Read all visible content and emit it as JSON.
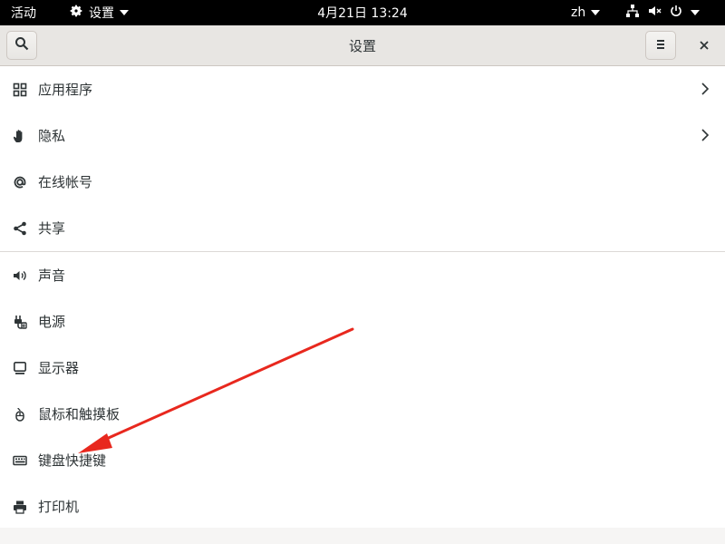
{
  "topbar": {
    "activities": "活动",
    "app_name": "设置",
    "clock": "4月21日  13:24",
    "language": "zh",
    "icons": [
      "network-icon",
      "mute-icon",
      "power-icon"
    ]
  },
  "header": {
    "title": "设置",
    "search_icon": "search-icon",
    "menu_icon": "hamburger-icon",
    "close_icon": "close-icon"
  },
  "sections": [
    {
      "items": [
        {
          "label": "应用程序",
          "icon": "apps-grid-icon",
          "has_chevron": true
        },
        {
          "label": "隐私",
          "icon": "hand-icon",
          "has_chevron": true
        },
        {
          "label": "在线帐号",
          "icon": "at-icon",
          "has_chevron": false
        },
        {
          "label": "共享",
          "icon": "share-icon",
          "has_chevron": false
        }
      ]
    },
    {
      "items": [
        {
          "label": "声音",
          "icon": "speaker-icon",
          "has_chevron": false
        },
        {
          "label": "电源",
          "icon": "power-plug-icon",
          "has_chevron": false
        },
        {
          "label": "显示器",
          "icon": "display-icon",
          "has_chevron": false
        },
        {
          "label": "鼠标和触摸板",
          "icon": "mouse-icon",
          "has_chevron": false
        },
        {
          "label": "键盘快捷键",
          "icon": "keyboard-icon",
          "has_chevron": false
        },
        {
          "label": "打印机",
          "icon": "printer-icon",
          "has_chevron": false
        }
      ]
    }
  ],
  "colors": {
    "topbar_bg": "#000000",
    "header_bg": "#e8e6e3",
    "list_bg": "#ffffff",
    "annotation_arrow": "#e8281e"
  }
}
